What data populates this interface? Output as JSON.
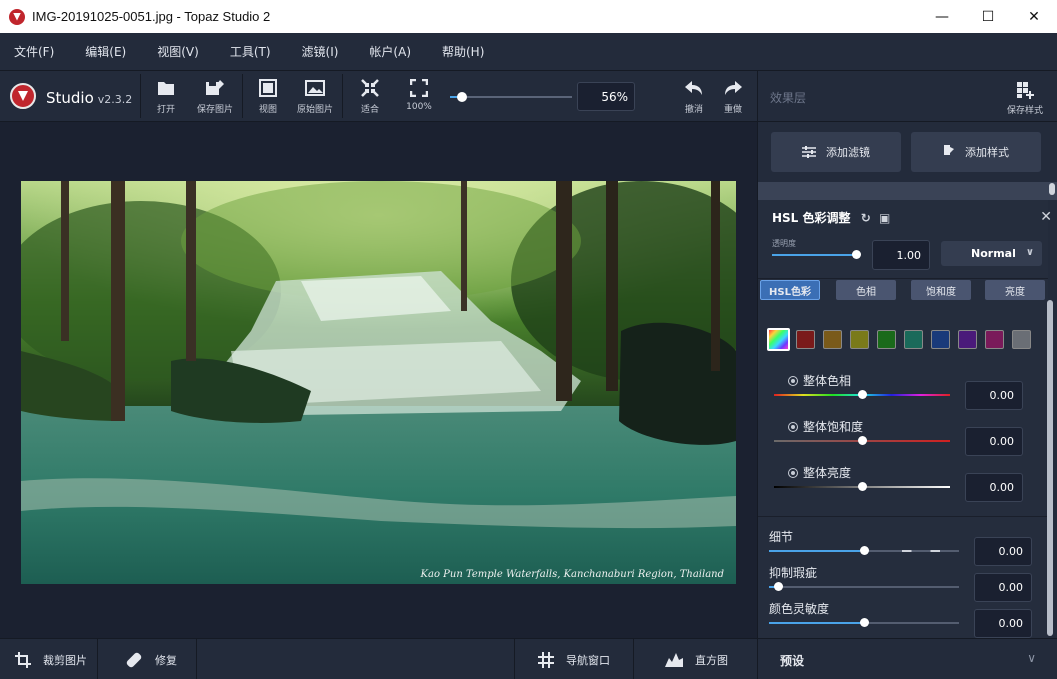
{
  "window": {
    "title": "IMG-20191025-0051.jpg - Topaz Studio 2",
    "minimize": "—",
    "maximize": "☐",
    "close": "✕"
  },
  "menu": [
    {
      "label": "文件(F)"
    },
    {
      "label": "编辑(E)"
    },
    {
      "label": "视图(V)"
    },
    {
      "label": "工具(T)"
    },
    {
      "label": "滤镜(I)"
    },
    {
      "label": "帐户(A)"
    },
    {
      "label": "帮助(H)"
    }
  ],
  "toolbar": {
    "brand": "Studio",
    "version": "v2.3.2",
    "open": "打开",
    "save_image": "保存图片",
    "view": "视图",
    "original": "原始图片",
    "fit": "适合",
    "zoom_100": "100%",
    "zoom_value": "56%",
    "zoom_fraction": 0.1,
    "undo": "撤消",
    "redo": "重做"
  },
  "photo": {
    "caption": "Kao Pun Temple Waterfalls, Kanchanaburi Region, Thailand"
  },
  "bottom": {
    "crop": "裁剪图片",
    "repair": "修复",
    "navigator": "导航窗口",
    "histogram": "直方图"
  },
  "panel": {
    "header": "效果层",
    "save_style": "保存样式",
    "add_filter": "添加滤镜",
    "add_style": "添加样式",
    "effect": {
      "title": "HSL 色彩调整",
      "opacity_label": "透明度",
      "opacity_value": "1.00",
      "opacity_fraction": 1.0,
      "blend_mode": "Normal",
      "tabs": [
        {
          "label": "HSL色彩"
        },
        {
          "label": "色相"
        },
        {
          "label": "饱和度"
        },
        {
          "label": "亮度"
        }
      ],
      "swatches": [
        "rainbow",
        "#7a1a1a",
        "#7a5a1a",
        "#7a7a1a",
        "#1a6a1a",
        "#1a6a5a",
        "#1a3a7a",
        "#4a1a7a",
        "#7a1a5a",
        "#6a6e75"
      ],
      "hsl": [
        {
          "label": "整体色相",
          "value": "0.00"
        },
        {
          "label": "整体饱和度",
          "value": "0.00"
        },
        {
          "label": "整体亮度",
          "value": "0.00"
        }
      ],
      "sliders": [
        {
          "label": "细节",
          "value": "0.00"
        },
        {
          "label": "抑制瑕疵",
          "value": "0.00"
        },
        {
          "label": "颜色灵敏度",
          "value": "0.00"
        }
      ]
    },
    "preset": "预设"
  }
}
